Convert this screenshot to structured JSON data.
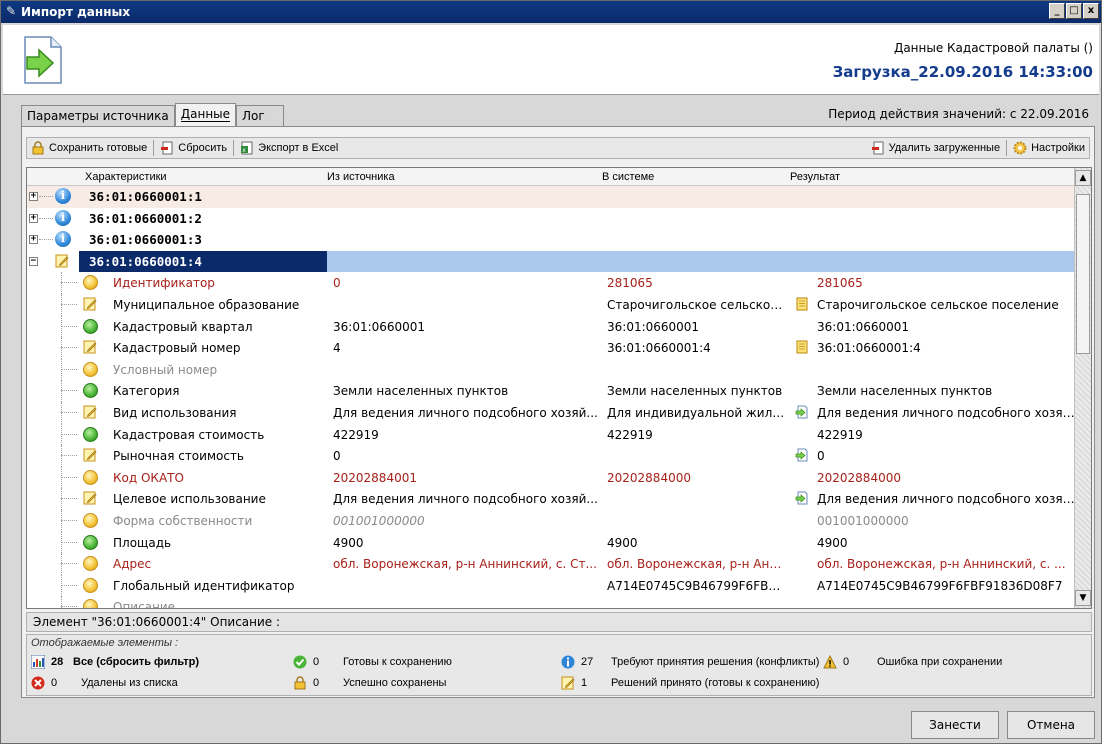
{
  "window": {
    "title": "Импорт данных",
    "controls": [
      "_",
      "□",
      "x"
    ]
  },
  "header": {
    "source_title": "Данные Кадастровой палаты ()",
    "load_title": "Загрузка_22.09.2016 14:33:00"
  },
  "tabs": [
    {
      "label": "Параметры источника",
      "active": false
    },
    {
      "label": "Данные",
      "active": true
    },
    {
      "label": "Лог",
      "active": false
    }
  ],
  "period_label": "Период действия значений:  с 22.09.2016",
  "toolbar": {
    "save_ready": "Сохранить готовые",
    "reset": "Сбросить",
    "export_excel": "Экспорт в Excel",
    "delete_loaded": "Удалить загруженные",
    "settings": "Настройки"
  },
  "grid": {
    "columns": [
      "Характеристики",
      "Из источника",
      "В системе",
      "Результат"
    ],
    "groups": [
      {
        "id": "36:01:0660001:1",
        "expanded": false
      },
      {
        "id": "36:01:0660001:2",
        "expanded": false
      },
      {
        "id": "36:01:0660001:3",
        "expanded": false
      },
      {
        "id": "36:01:0660001:4",
        "expanded": true
      }
    ],
    "rows": [
      {
        "icon": "yellow-dot",
        "name": "Идентификатор",
        "style": "red",
        "source": "0",
        "system": "281065",
        "result_icon": "",
        "result": "281065"
      },
      {
        "icon": "pencil",
        "name": "Муниципальное образование",
        "style": "",
        "source": "",
        "system": "Старочигольское сельское ...",
        "result_icon": "note",
        "result": "Старочигольское сельское поселение"
      },
      {
        "icon": "green-dot",
        "name": "Кадастровый квартал",
        "style": "",
        "source": "36:01:0660001",
        "system": "36:01:0660001",
        "result_icon": "",
        "result": "36:01:0660001"
      },
      {
        "icon": "pencil",
        "name": "Кадастровый номер",
        "style": "",
        "source": "4",
        "system": "36:01:0660001:4",
        "result_icon": "note",
        "result": "36:01:0660001:4"
      },
      {
        "icon": "yellow-dot",
        "name": "Условный номер",
        "style": "gray",
        "source": "",
        "system": "",
        "result_icon": "",
        "result": ""
      },
      {
        "icon": "green-dot",
        "name": "Категория",
        "style": "",
        "source": "Земли населенных пунктов",
        "system": "Земли населенных пунктов",
        "result_icon": "",
        "result": "Земли населенных пунктов"
      },
      {
        "icon": "pencil",
        "name": "Вид использования",
        "style": "",
        "source": "Для ведения личного подсобного хозяй...",
        "system": "Для индивидуальной жило...",
        "result_icon": "import",
        "result": "Для ведения личного подсобного хозяй..."
      },
      {
        "icon": "green-dot",
        "name": "Кадастровая стоимость",
        "style": "",
        "source": "422919",
        "system": "422919",
        "result_icon": "",
        "result": "422919"
      },
      {
        "icon": "pencil",
        "name": "Рыночная стоимость",
        "style": "",
        "source": "0",
        "system": "",
        "result_icon": "import",
        "result": "0"
      },
      {
        "icon": "yellow-dot",
        "name": "Код ОКАТО",
        "style": "red",
        "source": "20202884001",
        "system": "20202884000",
        "result_icon": "",
        "result": "20202884000"
      },
      {
        "icon": "pencil",
        "name": "Целевое использование",
        "style": "",
        "source": "Для ведения личного подсобного хозяй...",
        "system": "",
        "result_icon": "import",
        "result": "Для ведения личного подсобного хозяй..."
      },
      {
        "icon": "yellow-dot",
        "name": "Форма собственности",
        "style": "gray",
        "source": "001001000000",
        "source_style": "italic",
        "system": "",
        "result_icon": "",
        "result": "001001000000",
        "result_style": "gray"
      },
      {
        "icon": "green-dot",
        "name": "Площадь",
        "style": "",
        "source": "4900",
        "system": "4900",
        "result_icon": "",
        "result": "4900"
      },
      {
        "icon": "yellow-dot",
        "name": "Адрес",
        "style": "red",
        "source": "обл. Воронежская, р-н Аннинский, с. Ст...",
        "system": "обл. Воронежская,  р-н Анн...",
        "result_icon": "",
        "result": "обл. Воронежская,  р-н Аннинский,  с. ..."
      },
      {
        "icon": "yellow-dot",
        "name": "Глобальный идентификатор",
        "style": "",
        "source": "",
        "system": "A714E0745C9B46799F6FBF9...",
        "result_icon": "",
        "result": "A714E0745C9B46799F6FBF91836D08F7"
      },
      {
        "icon": "yellow-dot",
        "name": "Описание",
        "style": "gray",
        "source": "",
        "system": "",
        "result_icon": "",
        "result": ""
      }
    ]
  },
  "element_bar": "Элемент \"36:01:0660001:4\" Описание :",
  "legend": {
    "title": "Отображаемые элементы :",
    "items": [
      {
        "icon": "chart-icon",
        "count": "28",
        "label": "Все (сбросить фильтр)",
        "bold": true
      },
      {
        "icon": "check-icon",
        "count": "0",
        "label": "Готовы к сохранению"
      },
      {
        "icon": "info-icon",
        "count": "27",
        "label": "Требуют принятия решения (конфликты)"
      },
      {
        "icon": "warning-icon",
        "count": "0",
        "label": "Ошибка при сохранении"
      },
      {
        "icon": "error-icon",
        "count": "0",
        "label": "Удалены из списка"
      },
      {
        "icon": "lock-icon",
        "count": "0",
        "label": "Успешно сохранены"
      },
      {
        "icon": "pencil-icon",
        "count": "1",
        "label": "Решений принято (готовы к сохранению)"
      }
    ]
  },
  "buttons": {
    "apply": "Занести",
    "cancel": "Отмена"
  }
}
